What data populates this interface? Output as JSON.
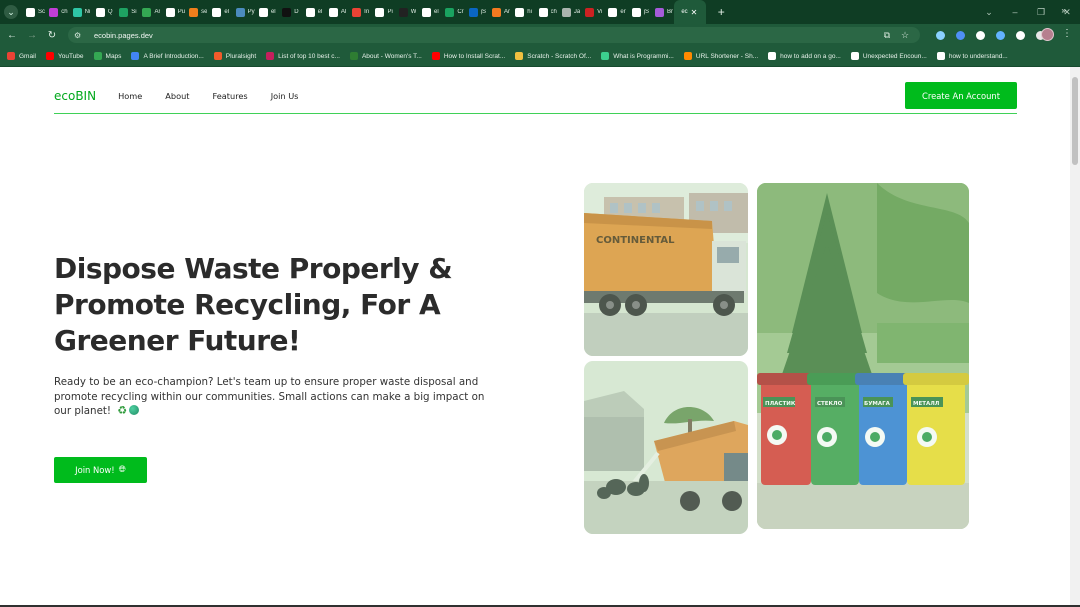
{
  "browser": {
    "tabs": [
      {
        "label": "Sc",
        "color": "#ffffff"
      },
      {
        "label": "ch",
        "color": "#c03ed6"
      },
      {
        "label": "Ni",
        "color": "#2ec7a6"
      },
      {
        "label": "Q",
        "color": "#ffffff"
      },
      {
        "label": "Si",
        "color": "#1ea362"
      },
      {
        "label": "Ar",
        "color": "#34a853"
      },
      {
        "label": "Pu",
        "color": "#ffffff"
      },
      {
        "label": "se",
        "color": "#f07f1c"
      },
      {
        "label": "el",
        "color": "#ffffff"
      },
      {
        "label": "Py",
        "color": "#4b8bbe"
      },
      {
        "label": "el",
        "color": "#ffffff"
      },
      {
        "label": "D",
        "color": "#111111"
      },
      {
        "label": "el",
        "color": "#ffffff"
      },
      {
        "label": "Al",
        "color": "#ffffff"
      },
      {
        "label": "In",
        "color": "#ea4335"
      },
      {
        "label": "Pi",
        "color": "#ffffff"
      },
      {
        "label": "W",
        "color": "#222222"
      },
      {
        "label": "el",
        "color": "#ffffff"
      },
      {
        "label": "Cr",
        "color": "#1aa260"
      },
      {
        "label": "jS",
        "color": "#0a66c2"
      },
      {
        "label": "Ar",
        "color": "#f47a20"
      },
      {
        "label": "hi",
        "color": "#ffffff"
      },
      {
        "label": "ch",
        "color": "#ffffff"
      },
      {
        "label": "Ja",
        "color": "#aab4ae"
      },
      {
        "label": "Vi",
        "color": "#cc2222"
      },
      {
        "label": "er",
        "color": "#ffffff"
      },
      {
        "label": "jS",
        "color": "#ffffff"
      },
      {
        "label": "Br",
        "color": "#a55bd9"
      }
    ],
    "active_tab": {
      "label": "ec",
      "close": "✕",
      "color": "#ffffff"
    },
    "new_tab": "+",
    "window_controls": [
      "⌄",
      "–",
      "❐",
      "✕"
    ],
    "nav": {
      "back": "←",
      "forward": "→",
      "reload": "↻"
    },
    "url": "ecobin.pages.dev",
    "extension_colors": [
      "#8ad1ff",
      "#4f8ff5",
      "#ffffff",
      "#63b3ff",
      "#ffffff",
      "#e7e7e7"
    ],
    "bookmarks": [
      {
        "label": "Gmail",
        "color": "#ea4335"
      },
      {
        "label": "YouTube",
        "color": "#ff0000"
      },
      {
        "label": "Maps",
        "color": "#34a853"
      },
      {
        "label": "A Brief Introduction...",
        "color": "#4285f4"
      },
      {
        "label": "Pluralsight",
        "color": "#f15b2a"
      },
      {
        "label": "List of top 10 best c...",
        "color": "#c51f5d"
      },
      {
        "label": "About - Women's T...",
        "color": "#2e7d32"
      },
      {
        "label": "How to Install Scrat...",
        "color": "#ff0000"
      },
      {
        "label": "Scratch - Scratch Of...",
        "color": "#f0c040"
      },
      {
        "label": "What is Programmi...",
        "color": "#3ccf8e"
      },
      {
        "label": "URL Shortener - Sh...",
        "color": "#ff8a00"
      },
      {
        "label": "how to add on a go...",
        "color": "#ffffff"
      },
      {
        "label": "Unexpected Encoun...",
        "color": "#ffffff"
      },
      {
        "label": "how to understand...",
        "color": "#ffffff"
      }
    ],
    "bookmarks_more": "»"
  },
  "site": {
    "brand": "ecoBIN",
    "nav_links": [
      "Home",
      "About",
      "Features",
      "Join Us"
    ],
    "cta": "Create An Account",
    "accent": "#00bb1c"
  },
  "hero": {
    "title_lines": [
      "Dispose Waste Properly &",
      "Promote Recycling, For A",
      "Greener Future!"
    ],
    "description": "Ready to be an eco-champion? Let's team up to ensure proper waste disposal and promote recycling within our communities. Small actions can make a big impact on our planet!",
    "description_emojis": [
      "♻️",
      "🌏"
    ],
    "button": "Join Now!",
    "button_icon": "globe-icon"
  },
  "photos": {
    "truck_text": "CONTINENTAL",
    "bin_labels": [
      "ПЛАСТИК",
      "СТЕКЛО",
      "БУМАГА",
      "МЕТАЛЛ"
    ]
  }
}
